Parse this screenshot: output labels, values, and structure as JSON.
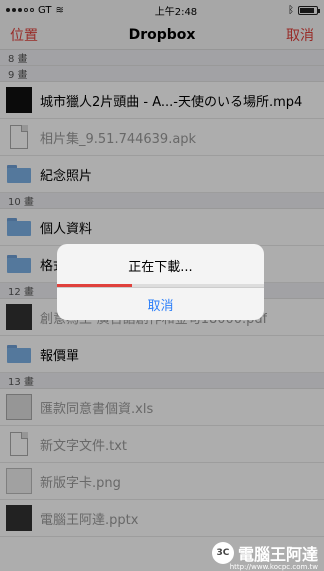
{
  "status": {
    "carrier": "GT",
    "time": "上午2:48"
  },
  "nav": {
    "left_label": "位置",
    "title": "Dropbox",
    "right_label": "取消"
  },
  "list": {
    "top_header": "8 畫",
    "sections": [
      {
        "header": "9 畫",
        "items": [
          {
            "label": "城市獵人2片頭曲 - A...-天使のいる場所.mp4",
            "type": "video",
            "dim": false
          },
          {
            "label": "相片集_9.51.744639.apk",
            "type": "file",
            "dim": true
          },
          {
            "label": "紀念照片",
            "type": "folder",
            "dim": false
          }
        ]
      },
      {
        "header": "10 畫",
        "items": [
          {
            "label": "個人資料",
            "type": "folder",
            "dim": false
          },
          {
            "label": "格式",
            "type": "folder",
            "dim": false
          }
        ]
      },
      {
        "header": "12 畫",
        "items": [
          {
            "label": "創意為王-廣告語創作和金句18000.pdf",
            "type": "dark",
            "dim": true
          },
          {
            "label": "報價單",
            "type": "folder",
            "dim": false
          }
        ]
      },
      {
        "header": "13 畫",
        "items": [
          {
            "label": "匯款同意書個資.xls",
            "type": "doc",
            "dim": true
          },
          {
            "label": "新文字文件.txt",
            "type": "file",
            "dim": true
          },
          {
            "label": "新版字卡.png",
            "type": "png",
            "dim": true
          },
          {
            "label": "電腦王阿達.pptx",
            "type": "dark",
            "dim": true
          }
        ]
      }
    ]
  },
  "alert": {
    "title": "正在下載...",
    "progress": 0.36,
    "progress_color": "#e0413c",
    "button_label": "取消",
    "button_color": "#2d7ff9"
  },
  "watermark": {
    "badge": "3C",
    "text": "電腦王阿達",
    "url": "http://www.kocpc.com.tw"
  },
  "colors": {
    "accent": "#e0413c",
    "folder": "#7db2e6"
  }
}
